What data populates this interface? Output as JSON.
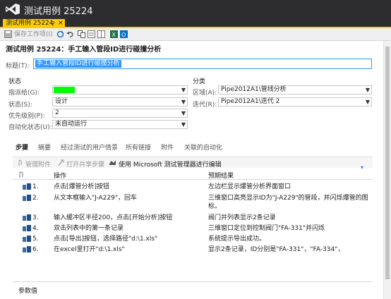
{
  "window": {
    "title": "测试用例 25224"
  },
  "tab": {
    "label": "测试用例 25224",
    "pin": "⚲",
    "close": "×"
  },
  "toolbar": {
    "save_label": "保存工作项(I)"
  },
  "work_item": {
    "header": "测试用例 25224：手工输入管段ID进行碰撞分析",
    "title_label": "标题(T):",
    "title_value": "手工输入管段ID进行碰撞分析"
  },
  "state_section": {
    "heading": "状态",
    "assigned_label": "指派给(G):",
    "state_label": "状态(S):",
    "state_value": "设计",
    "priority_label": "优先级别(P):",
    "priority_value": "2",
    "automation_label": "自动化状态(U):",
    "automation_value": "未自动运行"
  },
  "class_section": {
    "heading": "分类",
    "area_label": "区域(A):",
    "area_value": "Pipe2012A1\\管线分析",
    "iteration_label": "迭代(R):",
    "iteration_value": "Pipe2012A1\\迭代 2"
  },
  "subtabs": [
    "步骤",
    "摘要",
    "经过测试的用户情景",
    "所有链接",
    "附件",
    "关联的自动化"
  ],
  "steps_toolbar": {
    "manage_attachments": "管理附件",
    "open_shared": "打开共享步骤",
    "use_mtm": "使用 Microsoft 测试管理器进行编辑"
  },
  "grid": {
    "col_action": "操作",
    "col_expected": "预期结果",
    "rows": [
      {
        "num": "1.",
        "action": "点击[爆管分析]按钮",
        "expected": "左边栏显示爆管分析界面窗口"
      },
      {
        "num": "2.",
        "action": "从文本框输入\"J-A229\"，回车",
        "expected": "三维窗口高亮显示ID为\"J-A229\"的管段，并闪烁爆管的图标。"
      },
      {
        "num": "3.",
        "action": "输入缓冲区半径200，点击[开始分析]按钮",
        "expected": "阀门并列表显示2条记录"
      },
      {
        "num": "4.",
        "action": "双击列表中的第一条记录",
        "expected": "三维窗口定位到控制阀门\"FA-331\"并闪烁"
      },
      {
        "num": "5.",
        "action": "点击[导出]按钮，选择路径\"d:\\1.xls\"",
        "expected": "系统提示导出成功。"
      },
      {
        "num": "6.",
        "action": "在excel里打开\"d:\\1.xls\"",
        "expected": "显示2条记录，ID分别是\"FA-331\"，\"FA-334\"，"
      }
    ]
  },
  "params": {
    "label": "参数值"
  },
  "colors": {
    "accent": "#ffcc00",
    "assigned_swatch": "#00ff00",
    "selection": "#3399ff"
  }
}
